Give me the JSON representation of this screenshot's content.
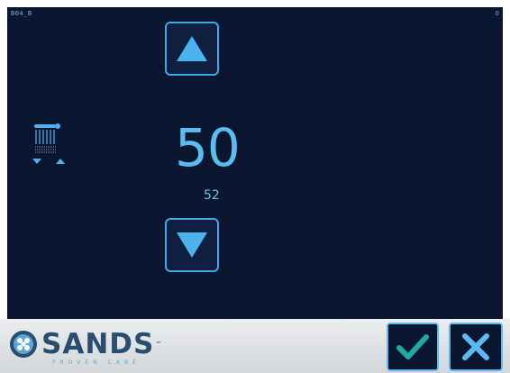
{
  "screen": {
    "id_label": "B04_B",
    "corner_value": "0"
  },
  "setting": {
    "value": "50",
    "secondary_value": "52"
  },
  "brand": {
    "name": "SANDS",
    "trademark": "™",
    "tagline": "PROVEN CARE"
  },
  "icons": {
    "increase": "triangle-up-icon",
    "decrease": "triangle-down-icon",
    "tool": "brush-height-icon",
    "confirm": "checkmark-icon",
    "cancel": "x-icon",
    "logo": "sands-logo-icon"
  },
  "colors": {
    "screen_bg": "#0b1631",
    "accent": "#3fa6e8",
    "value_text": "#5cbcf2",
    "brand_text": "#2a4c6f",
    "footer_bg": "#dfe2e4"
  }
}
